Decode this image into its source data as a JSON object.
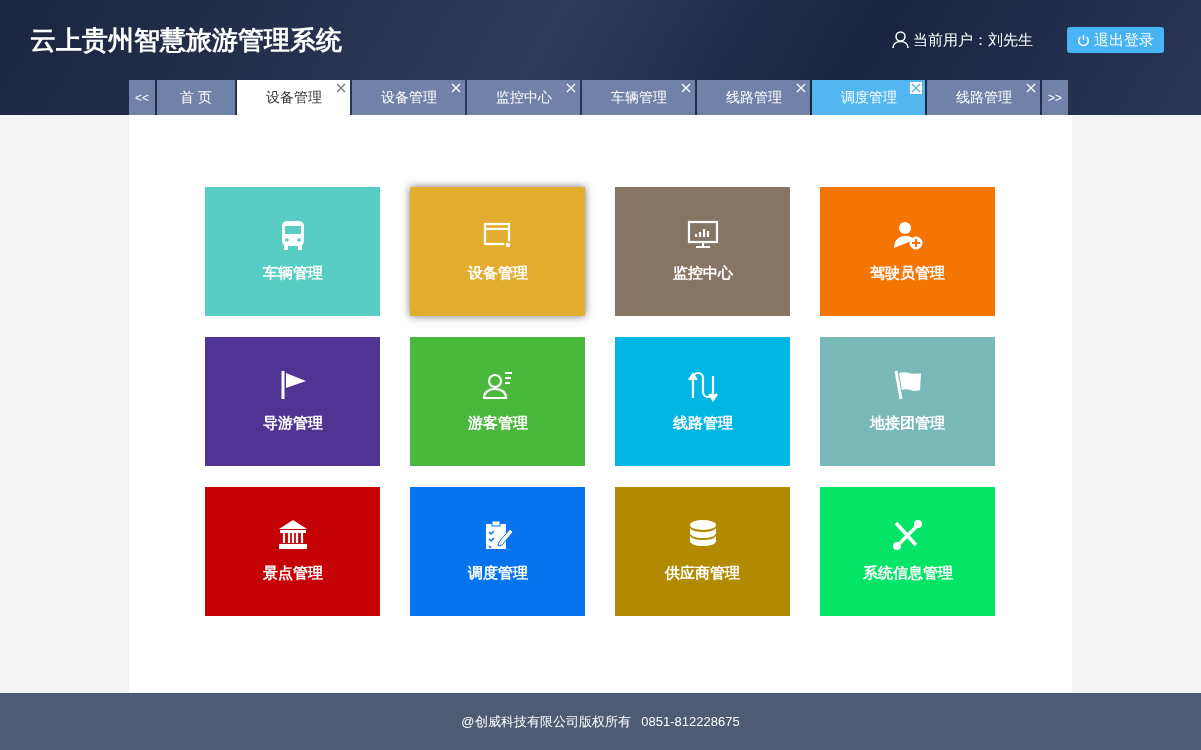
{
  "header": {
    "title": "云上贵州智慧旅游管理系统",
    "user_label": "当前用户：刘先生",
    "logout": "退出登录"
  },
  "tabs": {
    "prev": "<<",
    "next": ">>",
    "items": [
      {
        "label": "首 页",
        "closable": false,
        "selected": false,
        "hovered": false
      },
      {
        "label": "设备管理",
        "closable": true,
        "selected": true,
        "hovered": false
      },
      {
        "label": "设备管理",
        "closable": true,
        "selected": false,
        "hovered": false
      },
      {
        "label": "监控中心",
        "closable": true,
        "selected": false,
        "hovered": false
      },
      {
        "label": "车辆管理",
        "closable": true,
        "selected": false,
        "hovered": false
      },
      {
        "label": "线路管理",
        "closable": true,
        "selected": false,
        "hovered": false
      },
      {
        "label": "调度管理",
        "closable": true,
        "selected": false,
        "hovered": true
      },
      {
        "label": "线路管理",
        "closable": true,
        "selected": false,
        "hovered": false
      }
    ]
  },
  "tiles": [
    {
      "label": "车辆管理",
      "kind": "bus",
      "color": "#58cdc3",
      "selected": false
    },
    {
      "label": "设备管理",
      "kind": "device",
      "color": "#e3ae2f",
      "selected": true
    },
    {
      "label": "监控中心",
      "kind": "monitor",
      "color": "#857562",
      "selected": false
    },
    {
      "label": "驾驶员管理",
      "kind": "driver",
      "color": "#f57504",
      "selected": false
    },
    {
      "label": "导游管理",
      "kind": "guide",
      "color": "#4f3494",
      "selected": false
    },
    {
      "label": "游客管理",
      "kind": "tourist",
      "color": "#4ab83c",
      "selected": false
    },
    {
      "label": "线路管理",
      "kind": "route",
      "color": "#02b6e4",
      "selected": false
    },
    {
      "label": "地接团管理",
      "kind": "agency",
      "color": "#78b9b8",
      "selected": false
    },
    {
      "label": "景点管理",
      "kind": "scenic",
      "color": "#c50307",
      "selected": false
    },
    {
      "label": "调度管理",
      "kind": "dispatch",
      "color": "#0674ee",
      "selected": false
    },
    {
      "label": "供应商管理",
      "kind": "supplier",
      "color": "#b28a00",
      "selected": false
    },
    {
      "label": "系统信息管理",
      "kind": "system",
      "color": "#04e466",
      "selected": false
    }
  ],
  "footer": {
    "text": "@创威科技有限公司版权所有   0851-812228675"
  }
}
